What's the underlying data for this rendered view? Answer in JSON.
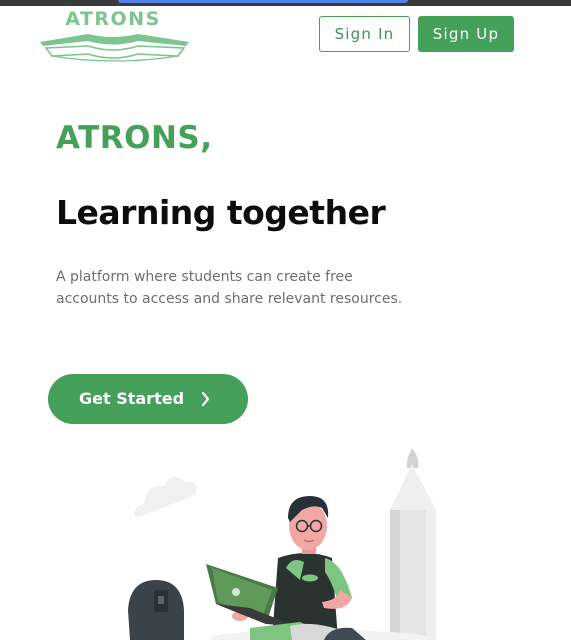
{
  "header": {
    "logo_text": "ATRONS",
    "sign_in_label": "Sign In",
    "sign_up_label": "Sign Up"
  },
  "hero": {
    "brand_title": "ATRONS,",
    "headline": "Learning together",
    "description_line1": "A platform where students can create free",
    "description_line2": "accounts to access and share relevant resources.",
    "cta_label": "Get Started"
  },
  "colors": {
    "brand_green": "#45a05a",
    "logo_green": "#7cc58e",
    "headline": "#0d0d0d",
    "body_text": "#6d6d6d"
  },
  "icons": {
    "cta_arrow": "chevron-right-icon",
    "logo_mark": "open-book-icon"
  }
}
